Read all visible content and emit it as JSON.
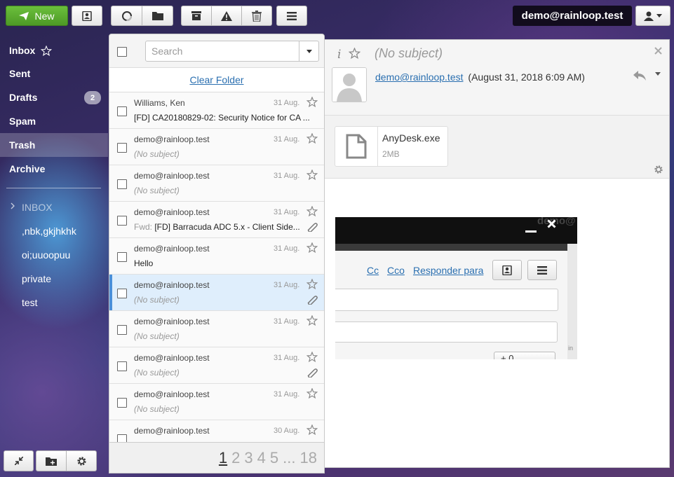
{
  "toolbar": {
    "new_label": "New",
    "user_email": "demo@rainloop.test"
  },
  "sidebar": {
    "folders": [
      {
        "label": "Inbox"
      },
      {
        "label": "Sent"
      },
      {
        "label": "Drafts",
        "badge": "2"
      },
      {
        "label": "Spam"
      },
      {
        "label": "Trash"
      },
      {
        "label": "Archive"
      }
    ],
    "subfolders": [
      {
        "label": "INBOX"
      },
      {
        "label": ",nbk,gkjhkhk"
      },
      {
        "label": "oi;uuoopuu"
      },
      {
        "label": "private"
      },
      {
        "label": "test"
      }
    ]
  },
  "list": {
    "search_placeholder": "Search",
    "clear_folder": "Clear Folder",
    "messages": [
      {
        "from": "Williams, Ken",
        "date": "31 Aug.",
        "subject": "[FD] CA20180829-02: Security Notice for CA ..."
      },
      {
        "from": "demo@rainloop.test",
        "date": "31 Aug.",
        "subject": "(No subject)"
      },
      {
        "from": "demo@rainloop.test",
        "date": "31 Aug.",
        "subject": "(No subject)"
      },
      {
        "from": "demo@rainloop.test",
        "date": "31 Aug.",
        "prefix": "Fwd:",
        "subject": " [FD] Barracuda ADC 5.x - Client Side..."
      },
      {
        "from": "demo@rainloop.test",
        "date": "31 Aug.",
        "subject": "Hello"
      },
      {
        "from": "demo@rainloop.test",
        "date": "31 Aug.",
        "subject": "(No subject)"
      },
      {
        "from": "demo@rainloop.test",
        "date": "31 Aug.",
        "subject": "(No subject)"
      },
      {
        "from": "demo@rainloop.test",
        "date": "31 Aug.",
        "subject": "(No subject)"
      },
      {
        "from": "demo@rainloop.test",
        "date": "31 Aug.",
        "subject": "(No subject)"
      },
      {
        "from": "demo@rainloop.test",
        "date": "30 Aug.",
        "subject": ""
      }
    ],
    "pages": [
      "1",
      "2",
      "3",
      "4",
      "5",
      "...",
      "18"
    ]
  },
  "viewer": {
    "subject": "(No subject)",
    "sender_email": "demo@rainloop.test",
    "sent_date": "(August 31, 2018 6:09 AM)",
    "attachment": {
      "name": "AnyDesk.exe",
      "size": "2MB"
    }
  },
  "embedded": {
    "header_text": "demo@",
    "cc": "Cc",
    "bcc": "Cco",
    "reply_to": "Responder para",
    "count_text": "+ 0",
    "side_text": "in"
  }
}
